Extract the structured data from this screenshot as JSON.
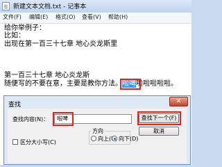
{
  "notepad": {
    "title": "新建文本文档.txt - 记事本",
    "menu": [
      "文件(F)",
      "编辑(E)",
      "格式(O)",
      "查看(V)",
      "帮助(H)"
    ],
    "lines": [
      "给你举例子：",
      "比如：",
      "出现在第一百三十七章 地心炎龙斯里",
      "第一百三十七章 地心炎龙斯",
      "随便写的不要在意，主要是教你方法。"
    ],
    "highlight_text": "啦啤",
    "after_highlight": "啦啦啦啦啦。"
  },
  "find_dialog": {
    "title": "查找",
    "close_glyph": "✕",
    "find_label": "查找内容(N)：",
    "find_value": "啦啤",
    "find_next_label": "查找下一个(F)",
    "cancel_label": "取消",
    "direction_label": "方向",
    "up_label": "向上(U)",
    "down_label": "向下(D)",
    "match_case_label": "区分大小写(C)",
    "direction_selected": "down",
    "match_case_checked": false
  },
  "colors": {
    "highlight_border": "#e8211c",
    "selection": "#3399ff"
  }
}
